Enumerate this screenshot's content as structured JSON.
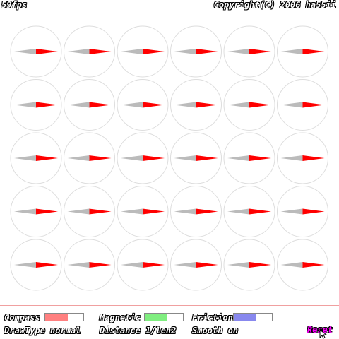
{
  "header": {
    "fps": "59fps",
    "copyright": "Copyright(C) 2006 ha55ii"
  },
  "compasses": {
    "rows": 5,
    "cols": 6,
    "north_color": "#ff0000",
    "south_color": "#bbbbbb",
    "ring_color": "#dddddd",
    "heading": "east"
  },
  "controls": {
    "compass": {
      "label": "Compass",
      "level": 0.6,
      "color": "#ff8080"
    },
    "magnetic": {
      "label": "Magnetic",
      "level": 0.6,
      "color": "#80ee80"
    },
    "friction": {
      "label": "Friction",
      "level": 0.6,
      "color": "#8888ee"
    }
  },
  "status": {
    "draw_type": "DrawType normal",
    "distance": "Distance 1/len2",
    "smooth": "Smooth on"
  },
  "reset_label": "Reset"
}
